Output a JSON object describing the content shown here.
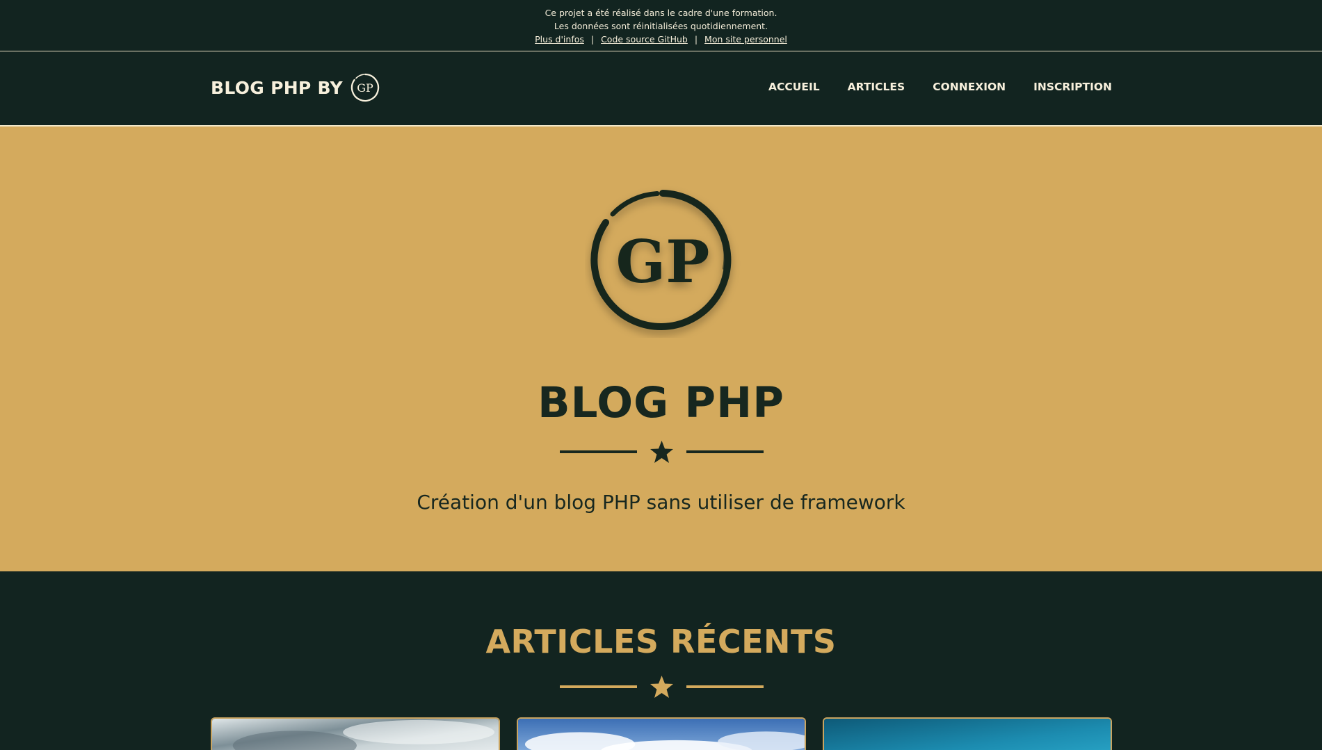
{
  "notice": {
    "line1": "Ce projet a été réalisé dans le cadre d'une formation.",
    "line2": "Les données sont réinitialisées quotidiennement.",
    "links": {
      "infos": "Plus d'infos",
      "github": "Code source GitHub",
      "site": "Mon site personnel"
    },
    "separator": "|"
  },
  "navbar": {
    "brand_text": "BLOG PHP BY",
    "brand_logo_text": "GP",
    "items": [
      {
        "label": "ACCUEIL"
      },
      {
        "label": "ARTICLES"
      },
      {
        "label": "CONNEXION"
      },
      {
        "label": "INSCRIPTION"
      }
    ]
  },
  "hero": {
    "logo_text": "GP",
    "title": "BLOG PHP",
    "divider_icon": "star-icon",
    "subtitle": "Création d'un blog PHP sans utiliser de framework"
  },
  "recent": {
    "title": "ARTICLES RÉCENTS",
    "divider_icon": "star-icon",
    "cards": [
      {
        "image": "blurred-gray-photo"
      },
      {
        "image": "blue-sky-clouds-photo"
      },
      {
        "image": "teal-ocean-photo"
      }
    ]
  },
  "colors": {
    "dark_green": "#122420",
    "gold": "#d4aa5d",
    "cream": "#f7f0dc",
    "ink": "#17271f"
  }
}
